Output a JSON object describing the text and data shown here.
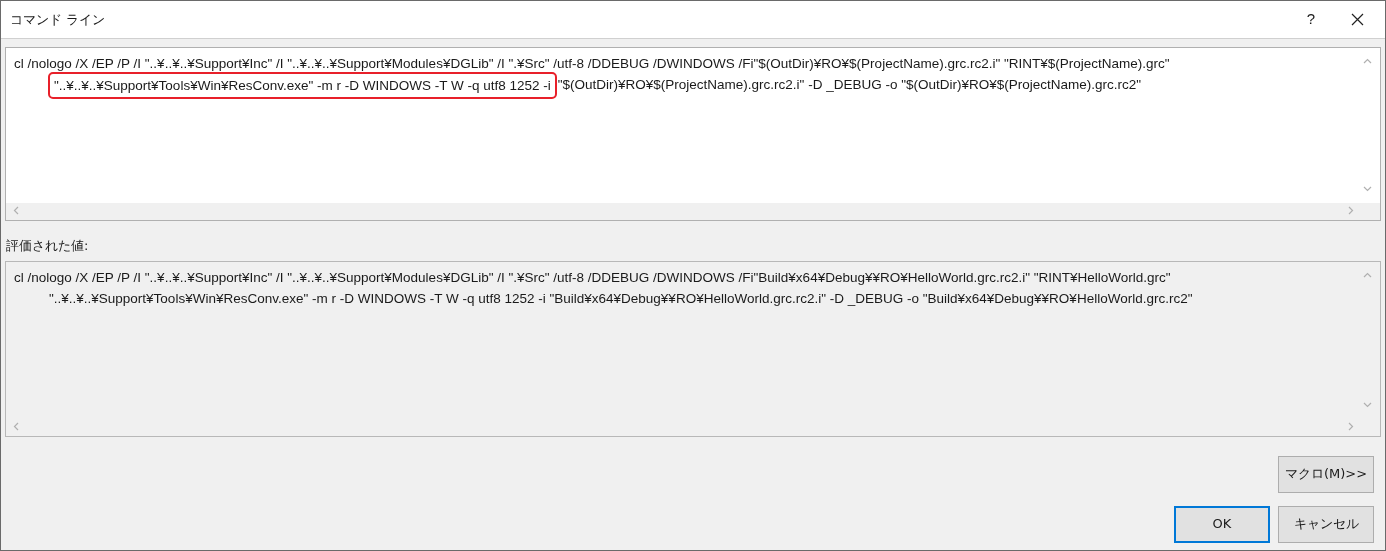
{
  "window": {
    "title": "コマンド ライン",
    "help": "?"
  },
  "editor": {
    "lines": [
      [
        {
          "text": "cl /nologo /X /EP /P /I \"..¥..¥..¥Support¥Inc\" /I \"..¥..¥..¥Support¥Modules¥DGLib\" /I \".¥Src\" /utf-8 /DDEBUG /DWINDOWS /Fi\"$(OutDir)¥RO¥$(ProjectName).grc.rc2.i\" \"RINT¥$(ProjectName).grc\"",
          "highlighted": false
        }
      ],
      [
        {
          "text": "\"..¥..¥..¥Support¥Tools¥Win¥ResConv.exe\" -m r -D WINDOWS -T W -q utf8 1252 -i",
          "highlighted": true
        },
        {
          "text": "\"$(OutDir)¥RO¥$(ProjectName).grc.rc2.i\" -D _DEBUG -o \"$(OutDir)¥RO¥$(ProjectName).grc.rc2\"",
          "highlighted": false
        }
      ]
    ]
  },
  "evaluated": {
    "label": "評価された値:",
    "lines": [
      "cl /nologo /X /EP /P /I \"..¥..¥..¥Support¥Inc\" /I \"..¥..¥..¥Support¥Modules¥DGLib\" /I \".¥Src\" /utf-8 /DDEBUG /DWINDOWS /Fi\"Build¥x64¥Debug¥¥RO¥HelloWorld.grc.rc2.i\" \"RINT¥HelloWorld.grc\"",
      "\"..¥..¥..¥Support¥Tools¥Win¥ResConv.exe\" -m r -D WINDOWS -T W -q utf8 1252 -i \"Build¥x64¥Debug¥¥RO¥HelloWorld.grc.rc2.i\" -D _DEBUG -o \"Build¥x64¥Debug¥¥RO¥HelloWorld.grc.rc2\""
    ]
  },
  "buttons": [
    {
      "label": "マクロ(M)>>",
      "kind": "macro",
      "default": false
    },
    {
      "label": "OK",
      "kind": "action",
      "default": true
    },
    {
      "label": "キャンセル",
      "kind": "action",
      "default": false
    }
  ]
}
